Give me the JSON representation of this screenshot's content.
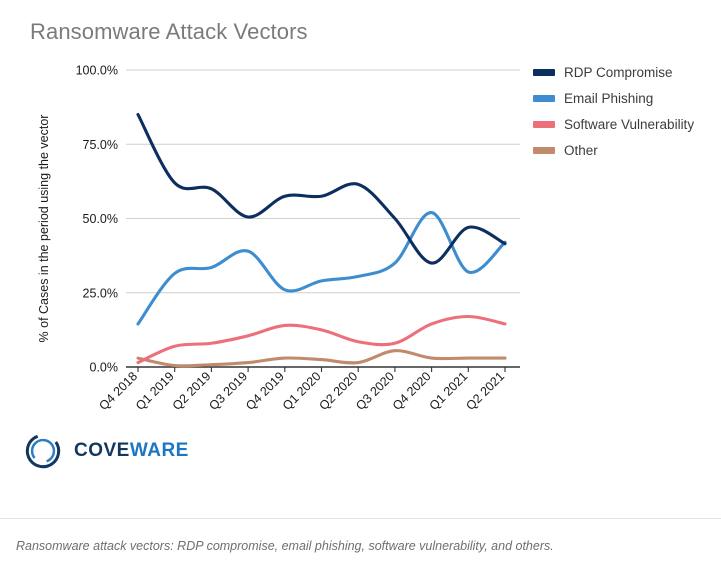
{
  "chart_title": "Ransomware Attack Vectors",
  "caption": "Ransomware attack vectors: RDP compromise, email phishing, software vulnerability, and others.",
  "logo": {
    "text_primary": "COVE",
    "text_secondary": "WARE",
    "mark_name": "coveware-ring-logo"
  },
  "legend": {
    "items": [
      {
        "label": "RDP Compromise",
        "color": "#0d2f60"
      },
      {
        "label": "Email Phishing",
        "color": "#3e8dd0"
      },
      {
        "label": "Software Vulnerability",
        "color": "#ee6f7c"
      },
      {
        "label": "Other",
        "color": "#c08a6b"
      }
    ]
  },
  "chart_data": {
    "type": "line",
    "title": "Ransomware Attack Vectors",
    "xlabel": "",
    "ylabel": "% of Cases in the period using the vector",
    "ylim": [
      0,
      100
    ],
    "ytick_labels": [
      "0.0%",
      "25.0%",
      "50.0%",
      "75.0%",
      "100.0%"
    ],
    "ytick_values": [
      0,
      25,
      50,
      75,
      100
    ],
    "grid": true,
    "legend_position": "right",
    "smoothing": "spline",
    "categories": [
      "Q4 2018",
      "Q1 2019",
      "Q2 2019",
      "Q3 2019",
      "Q4 2019",
      "Q1 2020",
      "Q2 2020",
      "Q3 2020",
      "Q4 2020",
      "Q1 2021",
      "Q2 2021"
    ],
    "series": [
      {
        "name": "RDP Compromise",
        "color": "#0d2f60",
        "values": [
          85.0,
          62.0,
          60.0,
          50.5,
          57.5,
          57.5,
          61.5,
          50.0,
          35.0,
          47.0,
          41.5
        ]
      },
      {
        "name": "Email Phishing",
        "color": "#3e8dd0",
        "values": [
          14.5,
          31.5,
          33.5,
          39.0,
          26.0,
          29.0,
          30.5,
          35.0,
          52.0,
          32.0,
          42.0
        ]
      },
      {
        "name": "Software Vulnerability",
        "color": "#ee6f7c",
        "values": [
          1.5,
          7.0,
          8.0,
          10.5,
          14.0,
          12.5,
          8.5,
          8.0,
          14.5,
          17.0,
          14.5
        ]
      },
      {
        "name": "Other",
        "color": "#c08a6b",
        "values": [
          3.0,
          0.5,
          0.8,
          1.5,
          3.0,
          2.5,
          1.5,
          5.5,
          3.0,
          3.0,
          3.0
        ]
      }
    ]
  }
}
